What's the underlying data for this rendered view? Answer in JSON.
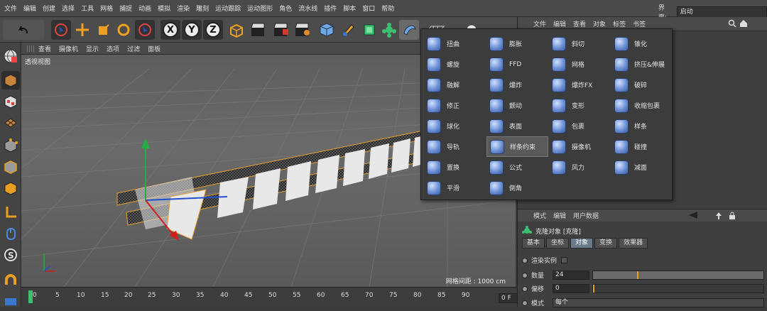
{
  "menubar": {
    "items": [
      "文件",
      "编辑",
      "创建",
      "选择",
      "工具",
      "网格",
      "捕捉",
      "动画",
      "模拟",
      "渲染",
      "雕刻",
      "运动跟踪",
      "运动图形",
      "角色",
      "流水线",
      "插件",
      "脚本",
      "窗口",
      "帮助"
    ],
    "interface_label": "界面:",
    "interface_value": "启动"
  },
  "toolbar": {
    "axis_x": "X",
    "axis_y": "Y",
    "axis_z": "Z"
  },
  "viewport": {
    "menu": [
      "查看",
      "摄像机",
      "显示",
      "选项",
      "过滤",
      "面板"
    ],
    "label": "透视视图",
    "grid_info": "网格间距 : 1000 cm"
  },
  "timeline": {
    "ticks": [
      "0",
      "5",
      "10",
      "15",
      "20",
      "25",
      "30",
      "35",
      "40",
      "45",
      "50",
      "55",
      "60",
      "65",
      "70",
      "75",
      "80",
      "85",
      "90"
    ],
    "frame_value": "0 F"
  },
  "object_manager": {
    "menu": [
      "文件",
      "编辑",
      "查看",
      "对象",
      "标签",
      "书签"
    ]
  },
  "deformer_popup": {
    "items": [
      [
        "扭曲",
        "膨胀",
        "斜切",
        "锥化"
      ],
      [
        "螺旋",
        "FFD",
        "网格",
        "挤压&伸展"
      ],
      [
        "融解",
        "爆炸",
        "爆炸FX",
        "破碎"
      ],
      [
        "修正",
        "颤动",
        "变形",
        "收缩包裹"
      ],
      [
        "球化",
        "表面",
        "包裹",
        "样条"
      ],
      [
        "导轨",
        "样条约束",
        "摄像机",
        "碰撞"
      ],
      [
        "置换",
        "公式",
        "风力",
        "减面"
      ],
      [
        "平滑",
        "倒角"
      ]
    ],
    "selected": "样条约束"
  },
  "attributes": {
    "menu": [
      "模式",
      "编辑",
      "用户数据"
    ],
    "object_title": "克隆对象 [克隆]",
    "tabs": [
      "基本",
      "坐标",
      "对象",
      "变换",
      "效果器"
    ],
    "active_tab": "对象",
    "render_instance_label": "渲染实例",
    "count_label": "数量",
    "count_value": "24",
    "count_fraction": 0.26,
    "offset_label": "偏移",
    "offset_value": "0",
    "mode_label": "模式",
    "mode_value": "每个"
  },
  "colors": {
    "accent": "#e8a020",
    "active_tab": "#6a7a8a",
    "x_axis": "#d02020",
    "y_axis": "#20b040",
    "z_axis": "#2050d0"
  }
}
